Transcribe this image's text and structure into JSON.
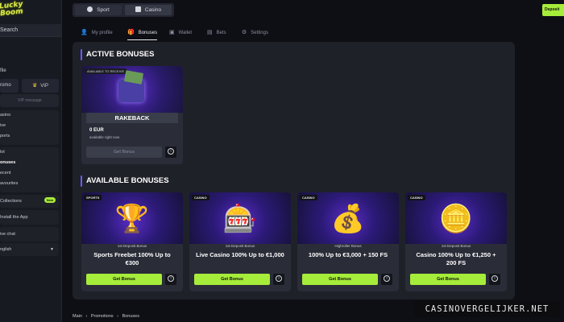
{
  "logo": {
    "line1": "Lucky",
    "line2": "Boom"
  },
  "sidebar": {
    "search": "Search",
    "profile_label": "file",
    "promo": "romo",
    "vip": "VIP",
    "message_placeholder": "VIP message",
    "group1": [
      "asino",
      "ive",
      "ports"
    ],
    "group2": [
      "lot",
      "onuses",
      "ecent",
      "avourites"
    ],
    "collections": "Collections",
    "collections_badge": "New",
    "install": "Install the App",
    "chat": "ive chat",
    "language": "nglish"
  },
  "topbar": {
    "sport": "Sport",
    "casino": "Casino",
    "deposit": "Deposit"
  },
  "tabs": [
    {
      "label": "My profile",
      "icon": "profile-icon"
    },
    {
      "label": "Bonuses",
      "icon": "gift-icon"
    },
    {
      "label": "Wallet",
      "icon": "wallet-icon"
    },
    {
      "label": "Bets",
      "icon": "bets-icon"
    },
    {
      "label": "Settings",
      "icon": "gear-icon"
    }
  ],
  "active": {
    "title": "ACTIVE BONUSES",
    "card": {
      "tag": "AVAILABLE TO RECEIVE",
      "name": "RAKEBACK",
      "amount": "0 EUR",
      "sub": "available right now",
      "button": "Get Bonus"
    }
  },
  "available": {
    "title": "AVAILABLE BONUSES",
    "cards": [
      {
        "tag": "SPORTS",
        "small": "1st Deposit Bonus",
        "title": "Sports Freebet 100% Up to €300",
        "button": "Get Bonus",
        "glyph": "🏆"
      },
      {
        "tag": "CASINO",
        "small": "1st Deposit Bonus",
        "title": "Live Casino 100% Up to €1,000",
        "button": "Get Bonus",
        "glyph": "🎰"
      },
      {
        "tag": "CASINO",
        "small": "Highroller Bonus",
        "title": "100% Up to €3,000 + 150 FS",
        "button": "Get Bonus",
        "glyph": "💰"
      },
      {
        "tag": "CASINO",
        "small": "1st Deposit Bonus",
        "title": "Casino 100% Up to €1,250 + 200 FS",
        "button": "Get Bonus",
        "glyph": "🪙"
      }
    ]
  },
  "breadcrumb": [
    "Main",
    "›",
    "Promotions",
    "›",
    "Bonuses"
  ],
  "watermark": "CASINOVERGELIJKER.NET",
  "colors": {
    "accent_green": "#a6ec3a",
    "accent_purple": "#6a5cff",
    "panel": "#1f2129",
    "background": "#0e0f14"
  }
}
